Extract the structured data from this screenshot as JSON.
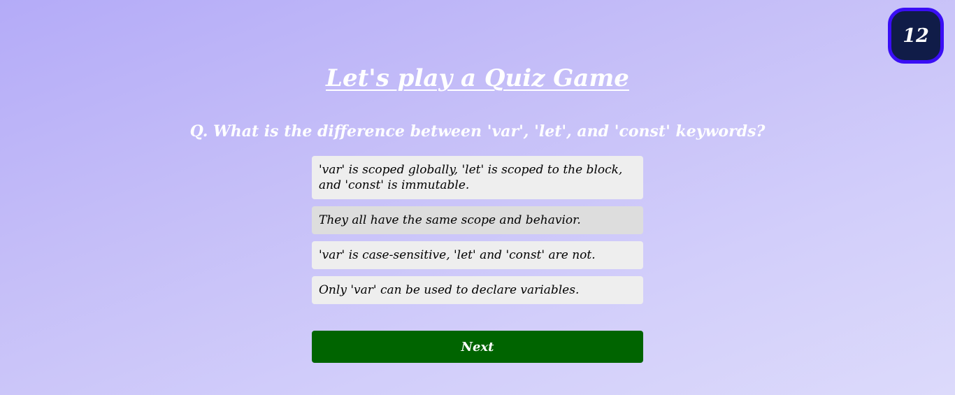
{
  "timer": {
    "value": "12"
  },
  "title": "Let's play a Quiz Game",
  "question": "Q. What is the difference between 'var', 'let', and 'const' keywords?",
  "options": [
    "'var' is scoped globally, 'let' is scoped to the block, and 'const' is immutable.",
    "They all have the same scope and behavior.",
    "'var' is case-sensitive, 'let' and 'const' are not.",
    "Only 'var' can be used to declare variables."
  ],
  "next_label": "Next",
  "colors": {
    "timer_bg": "#101c48",
    "timer_border": "#3a0ef5",
    "option_bg": "#eeeeee",
    "option_hover_bg": "#dddddd",
    "next_bg": "#006400"
  }
}
